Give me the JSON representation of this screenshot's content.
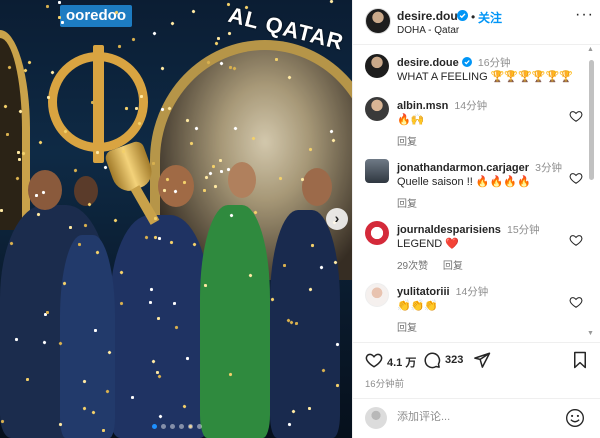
{
  "photo": {
    "sponsor_text": "ooredoo",
    "banner_text": "AL QATAR",
    "carousel_next_glyph": "›",
    "slide_count": 6,
    "active_slide": 1
  },
  "header": {
    "username": "desire.doue",
    "follow_label": "关注",
    "location": "DOHA - Qatar",
    "more_glyph": "···"
  },
  "caption": {
    "username": "desire.doue",
    "time": "16分钟",
    "text": "WHAT A FEELING",
    "emoji": "🏆🏆🏆🏆🏆🏆"
  },
  "comments": [
    {
      "username": "albin.msn",
      "time": "14分钟",
      "text": "🔥🙌",
      "likes": "",
      "reply_label": "回复"
    },
    {
      "username": "jonathandarmon.carjager",
      "time": "3分钟",
      "text": "Quelle saison !! ",
      "emoji": "🔥🔥🔥🔥",
      "likes": "",
      "reply_label": "回复"
    },
    {
      "username": "journaldesparisiens",
      "time": "15分钟",
      "text": "LEGEND ",
      "emoji": "❤️",
      "likes": "29次赞",
      "reply_label": "回复"
    },
    {
      "username": "yulitatoriii",
      "time": "14分钟",
      "text": "👏👏👏",
      "likes": "",
      "reply_label": "回复"
    }
  ],
  "actions": {
    "like_count": "4.1 万",
    "comment_count": "323",
    "post_time": "16分钟前"
  },
  "comment_box": {
    "placeholder": "添加评论..."
  },
  "colors": {
    "link_blue": "#0095f6",
    "verified_blue": "#0095f6",
    "heart_red": "#ed4956"
  }
}
